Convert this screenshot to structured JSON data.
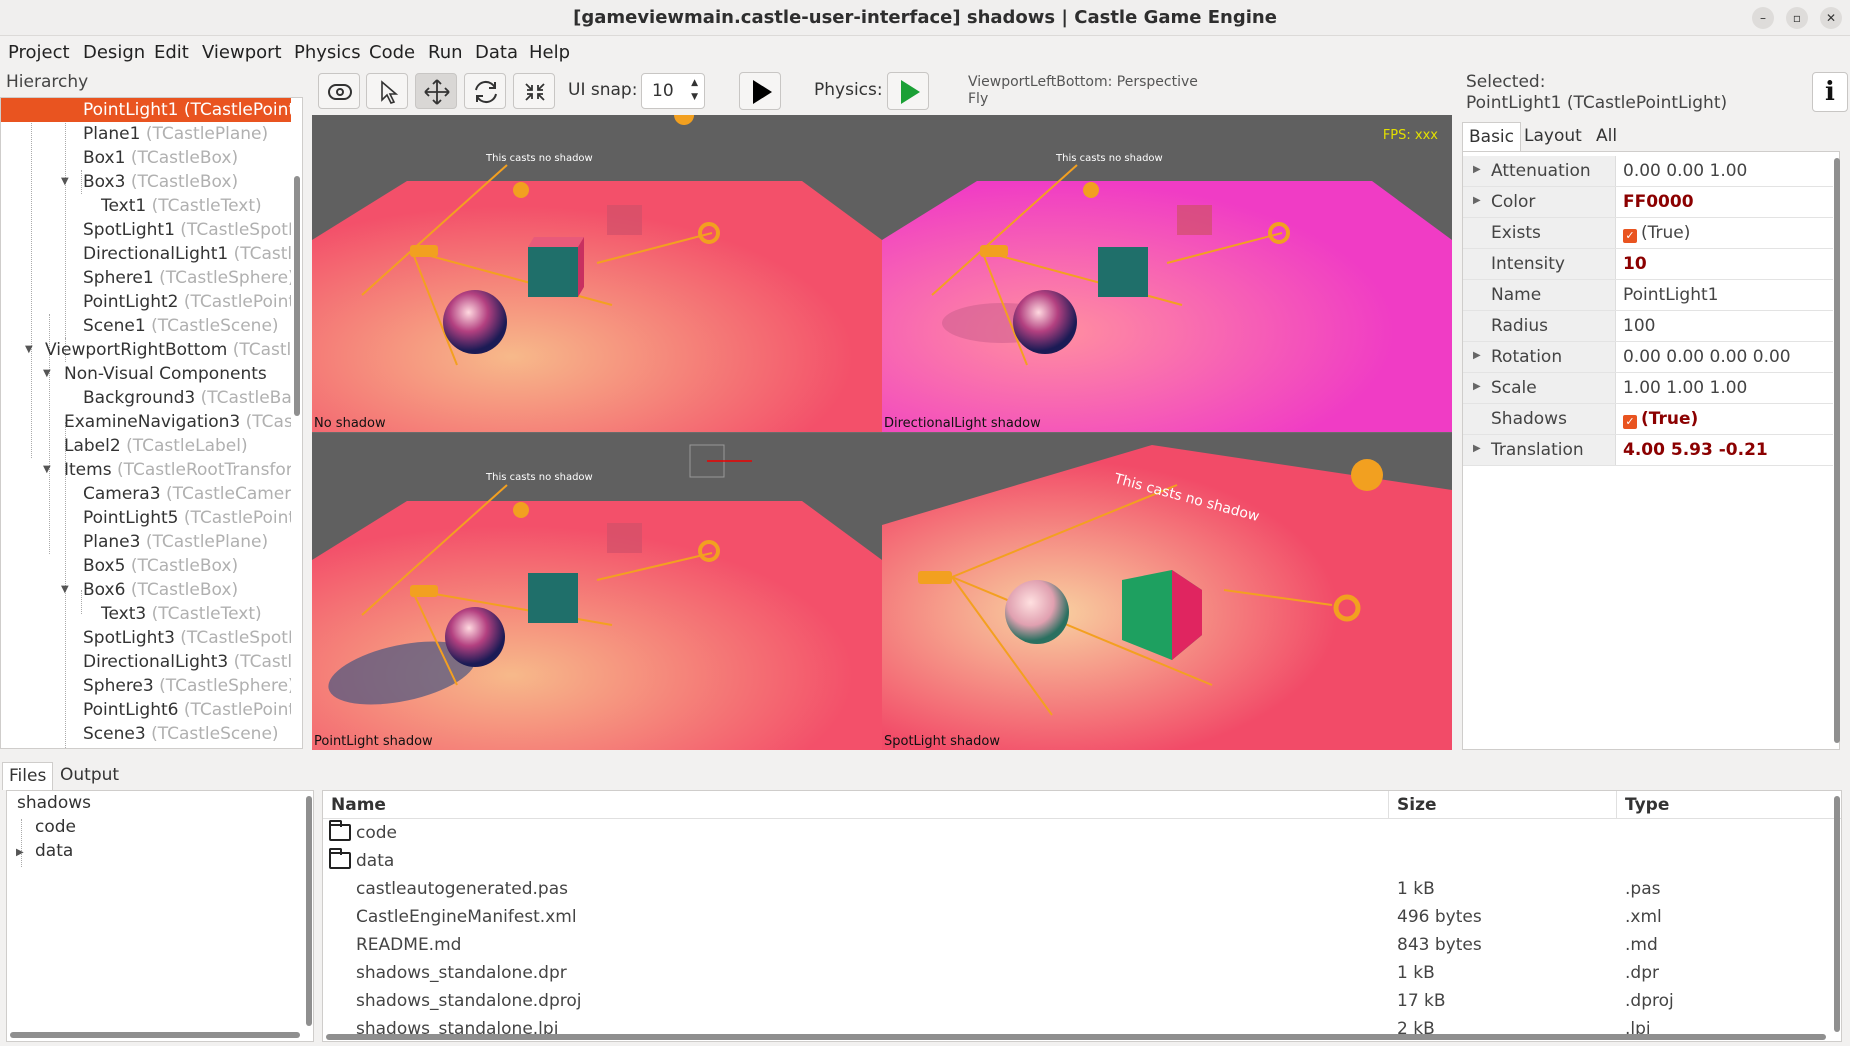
{
  "window": {
    "title": "[gameviewmain.castle-user-interface] shadows | Castle Game Engine",
    "minimize": "–",
    "maximize": "▫",
    "close": "✕"
  },
  "menu": [
    "Project",
    "Design",
    "Edit",
    "Viewport",
    "Physics",
    "Code",
    "Run",
    "Data",
    "Help"
  ],
  "hierarchy": {
    "label": "Hierarchy",
    "items": [
      {
        "name": "PointLight1",
        "type": "(TCastlePointLight)",
        "selected": true
      },
      {
        "name": "Plane1",
        "type": "(TCastlePlane)"
      },
      {
        "name": "Box1",
        "type": "(TCastleBox)"
      },
      {
        "name": "Box3",
        "type": "(TCastleBox)"
      },
      {
        "name": "Text1",
        "type": "(TCastleText)"
      },
      {
        "name": "SpotLight1",
        "type": "(TCastleSpotLight)"
      },
      {
        "name": "DirectionalLight1",
        "type": "(TCastleDirectionalLight)"
      },
      {
        "name": "Sphere1",
        "type": "(TCastleSphere)"
      },
      {
        "name": "PointLight2",
        "type": "(TCastlePointLight)"
      },
      {
        "name": "Scene1",
        "type": "(TCastleScene)"
      },
      {
        "name": "ViewportRightBottom",
        "type": "(TCastleViewport)"
      },
      {
        "name": "Non-Visual Components",
        "type": ""
      },
      {
        "name": "Background3",
        "type": "(TCastleBackground)"
      },
      {
        "name": "ExamineNavigation3",
        "type": "(TCastleExamineNavigation)"
      },
      {
        "name": "Label2",
        "type": "(TCastleLabel)"
      },
      {
        "name": "Items",
        "type": "(TCastleRootTransform)"
      },
      {
        "name": "Camera3",
        "type": "(TCastleCamera)"
      },
      {
        "name": "PointLight5",
        "type": "(TCastlePointLight)"
      },
      {
        "name": "Plane3",
        "type": "(TCastlePlane)"
      },
      {
        "name": "Box5",
        "type": "(TCastleBox)"
      },
      {
        "name": "Box6",
        "type": "(TCastleBox)"
      },
      {
        "name": "Text3",
        "type": "(TCastleText)"
      },
      {
        "name": "SpotLight3",
        "type": "(TCastleSpotLight)"
      },
      {
        "name": "DirectionalLight3",
        "type": "(TCastleDirectionalLight)"
      },
      {
        "name": "Sphere3",
        "type": "(TCastleSphere)"
      },
      {
        "name": "PointLight6",
        "type": "(TCastlePointLight)"
      },
      {
        "name": "Scene3",
        "type": "(TCastleScene)"
      }
    ]
  },
  "toolbar": {
    "ui_snap_label": "UI snap:",
    "ui_snap_value": "10",
    "physics_label": "Physics:",
    "viewport_info_line1": "ViewportLeftBottom: Perspective",
    "viewport_info_line2": "Fly"
  },
  "viewport": {
    "fps": "FPS: xxx",
    "quadrants": [
      {
        "caption": "No shadow",
        "text3d": "This casts no shadow"
      },
      {
        "caption": "DirectionalLight shadow",
        "text3d": "This casts no shadow"
      },
      {
        "caption": "PointLight shadow",
        "text3d": "This casts no shadow"
      },
      {
        "caption": "SpotLight shadow",
        "text3d": "This casts no shadow"
      }
    ]
  },
  "inspector": {
    "selected_label": "Selected:",
    "selected_value": "PointLight1 (TCastlePointLight)",
    "info_button": "i",
    "tabs": [
      "Basic",
      "Layout",
      "All"
    ],
    "properties": [
      {
        "name": "Attenuation",
        "value": "0.00 0.00 1.00",
        "expandable": true,
        "modified": false
      },
      {
        "name": "Color",
        "value": "FF0000",
        "expandable": true,
        "modified": true
      },
      {
        "name": "Exists",
        "value": "(True)",
        "checkbox": true,
        "modified": false
      },
      {
        "name": "Intensity",
        "value": "10",
        "modified": true
      },
      {
        "name": "Name",
        "value": "PointLight1",
        "modified": false
      },
      {
        "name": "Radius",
        "value": "100",
        "modified": false
      },
      {
        "name": "Rotation",
        "value": "0.00 0.00 0.00 0.00",
        "expandable": true,
        "modified": false
      },
      {
        "name": "Scale",
        "value": "1.00 1.00 1.00",
        "expandable": true,
        "modified": false
      },
      {
        "name": "Shadows",
        "value": "(True)",
        "checkbox": true,
        "modified": true
      },
      {
        "name": "Translation",
        "value": "4.00 5.93 -0.21",
        "expandable": true,
        "modified": true
      }
    ]
  },
  "bottom": {
    "tabs": [
      "Files",
      "Output"
    ],
    "tree": [
      "shadows",
      "code",
      "data"
    ],
    "columns": [
      "Name",
      "Size",
      "Type"
    ],
    "files": [
      {
        "name": "code",
        "size": "",
        "type": "",
        "folder": true
      },
      {
        "name": "data",
        "size": "",
        "type": "",
        "folder": true
      },
      {
        "name": "castleautogenerated.pas",
        "size": "1 kB",
        "type": ".pas"
      },
      {
        "name": "CastleEngineManifest.xml",
        "size": "496 bytes",
        "type": ".xml"
      },
      {
        "name": "README.md",
        "size": "843 bytes",
        "type": ".md"
      },
      {
        "name": "shadows_standalone.dpr",
        "size": "1 kB",
        "type": ".dpr"
      },
      {
        "name": "shadows_standalone.dproj",
        "size": "17 kB",
        "type": ".dproj"
      },
      {
        "name": "shadows_standalone.lpi",
        "size": "2 kB",
        "type": ".lpi"
      }
    ]
  }
}
